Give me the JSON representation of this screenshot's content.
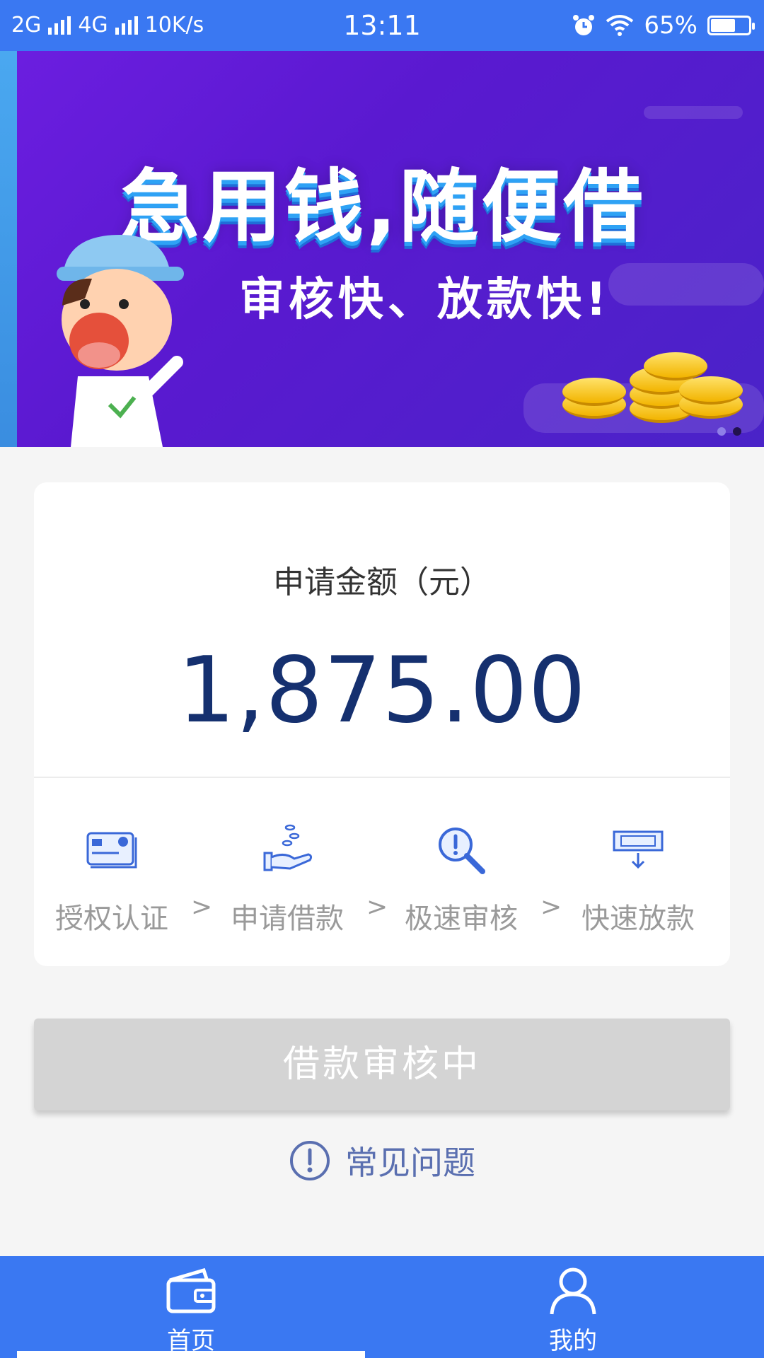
{
  "status_bar": {
    "network1": "2G",
    "network2": "4G",
    "speed": "10K/s",
    "time": "13:11",
    "battery_percent": "65%",
    "battery_level": 0.65
  },
  "banner": {
    "headline": "急用钱,随便借",
    "subline": "审核快、放款快!",
    "slide_count": 2,
    "active_slide": 2
  },
  "loan_card": {
    "amount_label": "申请金额（元）",
    "amount": "1,875.00",
    "steps": [
      {
        "label": "授权认证",
        "icon": "id-card-icon"
      },
      {
        "label": "申请借款",
        "icon": "hand-coins-icon"
      },
      {
        "label": "极速审核",
        "icon": "magnifier-alert-icon"
      },
      {
        "label": "快速放款",
        "icon": "cash-out-icon"
      }
    ],
    "separator": ">"
  },
  "action": {
    "button_label": "借款审核中",
    "faq_label": "常见问题"
  },
  "bottom_nav": {
    "items": [
      {
        "label": "首页",
        "icon": "wallet-icon",
        "active": true
      },
      {
        "label": "我的",
        "icon": "user-icon",
        "active": false
      }
    ]
  },
  "colors": {
    "primary": "#3a78f2",
    "amount": "#15306f",
    "disabled_button": "#d4d4d4"
  }
}
